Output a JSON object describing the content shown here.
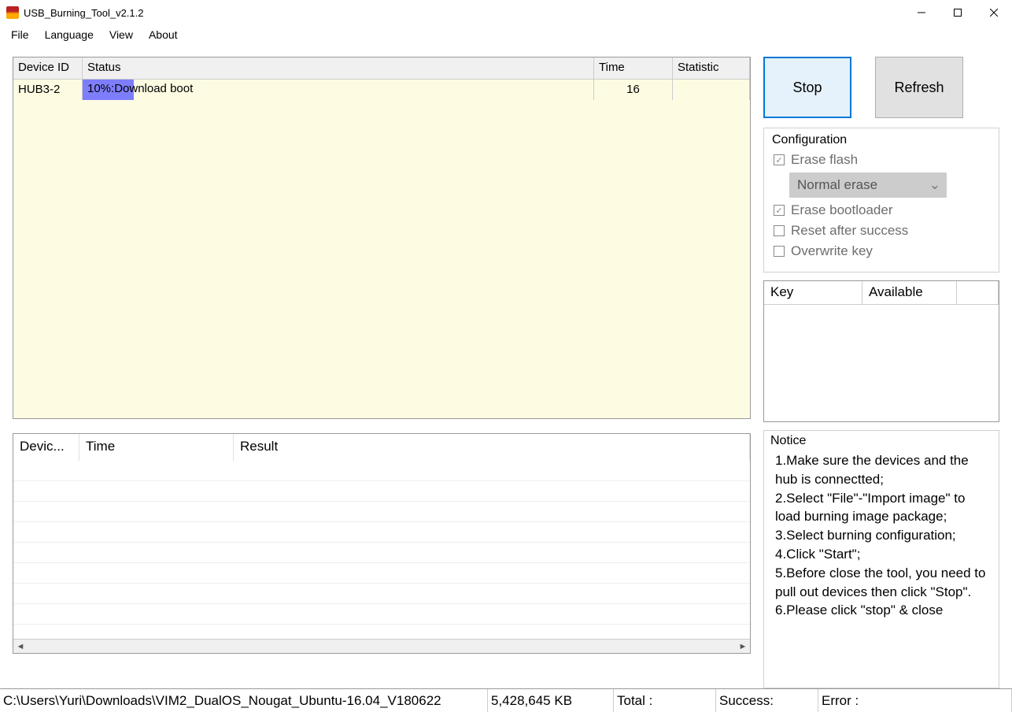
{
  "window": {
    "title": "USB_Burning_Tool_v2.1.2"
  },
  "menu": {
    "file": "File",
    "language": "Language",
    "view": "View",
    "about": "About"
  },
  "device_headers": {
    "id": "Device ID",
    "status": "Status",
    "time": "Time",
    "stat": "Statistic"
  },
  "device_row": {
    "id": "HUB3-2",
    "status": "10%:Download boot",
    "progress_pct": 10,
    "time": "16",
    "stat": ""
  },
  "result_headers": {
    "dev": "Devic...",
    "time": "Time",
    "res": "Result"
  },
  "buttons": {
    "stop": "Stop",
    "refresh": "Refresh"
  },
  "config": {
    "title": "Configuration",
    "erase_flash": {
      "label": "Erase flash",
      "checked": true
    },
    "erase_mode": "Normal erase",
    "erase_bootloader": {
      "label": "Erase bootloader",
      "checked": true
    },
    "reset_after": {
      "label": "Reset after success",
      "checked": false
    },
    "overwrite_key": {
      "label": "Overwrite key",
      "checked": false
    }
  },
  "key_headers": {
    "key": "Key",
    "available": "Available"
  },
  "notice": {
    "title": "Notice",
    "items": [
      "1.Make sure the devices and the hub is connectted;",
      "2.Select \"File\"-\"Import image\" to load burning image package;",
      "3.Select burning configuration;",
      "4.Click \"Start\";",
      "5.Before close the tool, you need to pull out devices then click \"Stop\".",
      "6.Please click \"stop\" & close"
    ]
  },
  "statusbar": {
    "path": "C:\\Users\\Yuri\\Downloads\\VIM2_DualOS_Nougat_Ubuntu-16.04_V180622",
    "size": "5,428,645 KB",
    "total": "Total :",
    "success": "Success:",
    "error": "Error :"
  }
}
